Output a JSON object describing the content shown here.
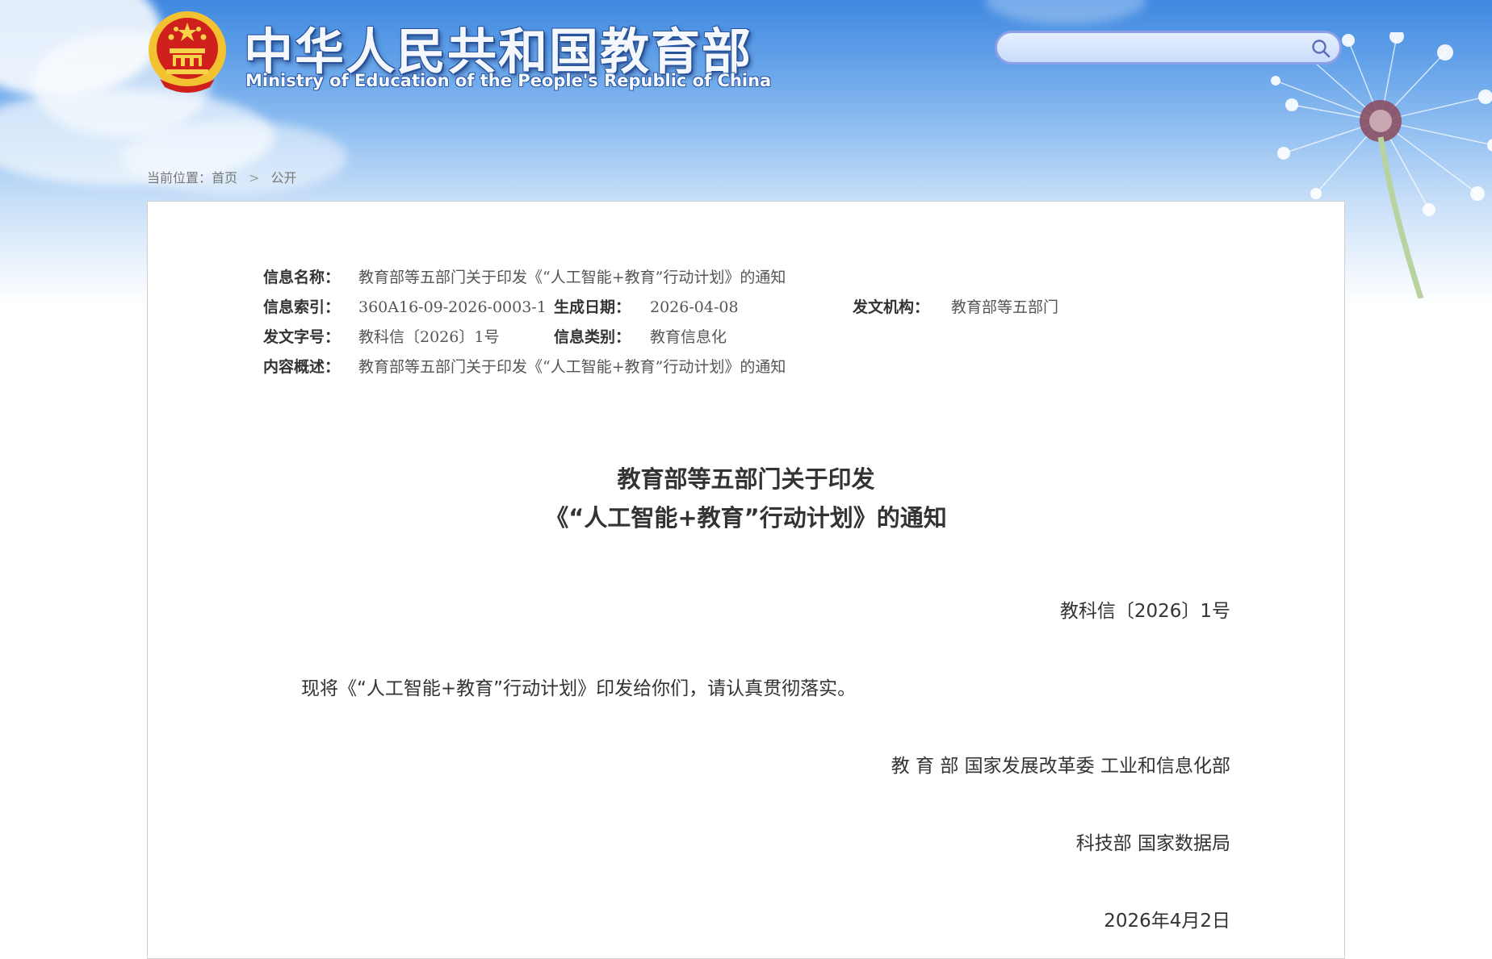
{
  "header": {
    "site_title": "中华人民共和国教育部",
    "site_subtitle": "Ministry of Education of the People's Republic of China",
    "search": {
      "value": "",
      "placeholder": ""
    }
  },
  "breadcrumb": {
    "prefix": "当前位置：",
    "items": [
      "首页",
      "公开"
    ],
    "separator": ">"
  },
  "meta": {
    "name_label": "信息名称：",
    "name_value": "教育部等五部门关于印发《“人工智能+教育”行动计划》的通知",
    "index_label": "信息索引：",
    "index_value": "360A16-09-2026-0003-1",
    "date_label": "生成日期：",
    "date_value": "2026-04-08",
    "issuer_label": "发文机构：",
    "issuer_value": "教育部等五部门",
    "doc_no_label": "发文字号：",
    "doc_no_value": "教科信〔2026〕1号",
    "category_label": "信息类别：",
    "category_value": "教育信息化",
    "summary_label": "内容概述：",
    "summary_value": "教育部等五部门关于印发《“人工智能+教育”行动计划》的通知"
  },
  "document": {
    "title_line1": "教育部等五部门关于印发",
    "title_line2": "《“人工智能+教育”行动计划》的通知",
    "doc_number": "教科信〔2026〕1号",
    "body": "现将《“人工智能+教育”行动计划》印发给你们，请认真贯彻落实。",
    "signatories_line1": "教 育 部  国家发展改革委  工业和信息化部",
    "signatories_line2": "科技部  国家数据局",
    "date": "2026年4月2日"
  },
  "colors": {
    "sky_top": "#3f88e0",
    "title_outline": "#27539e",
    "search_border": "#8d9fe6",
    "emblem_red": "#d0201d",
    "emblem_gold": "#f2c230"
  },
  "icons": {
    "emblem": "national-emblem-icon",
    "search": "search-icon"
  }
}
